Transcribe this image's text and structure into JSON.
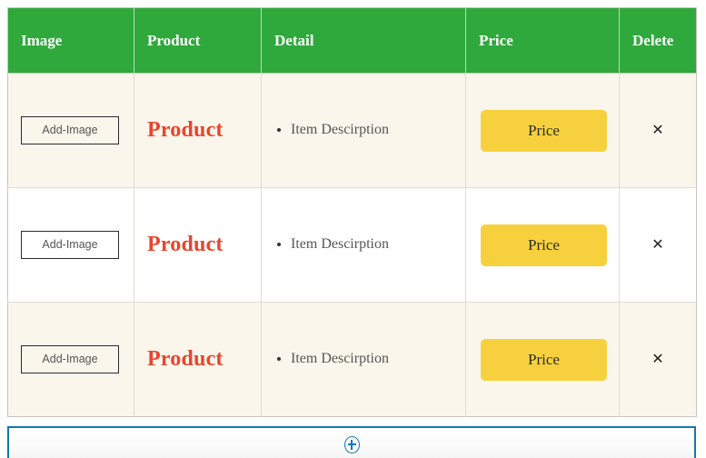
{
  "table": {
    "columns": [
      {
        "key": "image",
        "label": "Image"
      },
      {
        "key": "product",
        "label": "Product"
      },
      {
        "key": "detail",
        "label": "Detail"
      },
      {
        "key": "price",
        "label": "Price"
      },
      {
        "key": "delete",
        "label": "Delete"
      }
    ],
    "rows": [
      {
        "image_button_label": "Add-Image",
        "product_name": "Product",
        "detail_items": [
          "Item Descirption"
        ],
        "price_button_label": "Price",
        "delete_icon": "close-x-icon"
      },
      {
        "image_button_label": "Add-Image",
        "product_name": "Product",
        "detail_items": [
          "Item Descirption"
        ],
        "price_button_label": "Price",
        "delete_icon": "close-x-icon"
      },
      {
        "image_button_label": "Add-Image",
        "product_name": "Product",
        "detail_items": [
          "Item Descirption"
        ],
        "price_button_label": "Price",
        "delete_icon": "close-x-icon"
      }
    ]
  },
  "add_row": {
    "icon": "plus-circle-icon",
    "label": ""
  },
  "colors": {
    "header_green": "#2fa93c",
    "row_alt_beige": "#faf6ec",
    "row_plain_white": "#ffffff",
    "product_red": "#e8452c",
    "price_yellow": "#f7d13d",
    "add_row_blue": "#1277b0",
    "border_gray": "#dedbd2"
  },
  "glyphs": {
    "close_x": "✕",
    "bullet": "•"
  }
}
